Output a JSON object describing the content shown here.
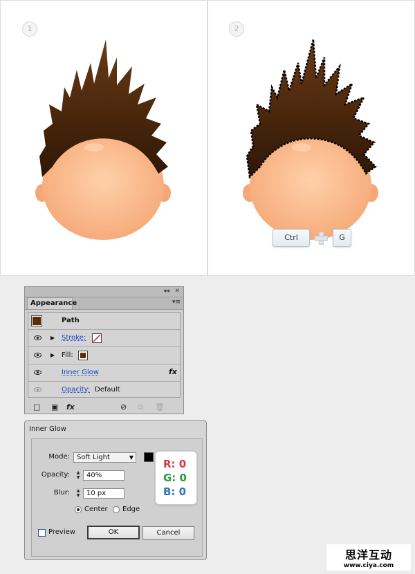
{
  "steps": {
    "one": "1",
    "two": "2"
  },
  "shortcut": {
    "ctrl": "Ctrl",
    "g": "G"
  },
  "appearance": {
    "tab": "Appearance",
    "object": "Path",
    "rows": {
      "stroke": "Stroke:",
      "fill": "Fill:",
      "inner_glow": "Inner Glow",
      "fx": "fx",
      "opacity_label": "Opacity:",
      "opacity_value": "Default"
    },
    "fill_color": "#5a2e0c",
    "stroke_color": "none"
  },
  "inner_glow": {
    "title": "Inner Glow",
    "mode_label": "Mode:",
    "mode_value": "Soft Light",
    "opacity_label": "Opacity:",
    "opacity_value": "40%",
    "blur_label": "Blur:",
    "blur_value": "10 px",
    "center_label": "Center",
    "edge_label": "Edge",
    "selected": "Center",
    "preview_label": "Preview",
    "ok": "OK",
    "cancel": "Cancel",
    "glow_color": "#000000"
  },
  "rgb": {
    "r": "R: 0",
    "g": "G: 0",
    "b": "B: 0",
    "r_color": "#e0343c",
    "g_color": "#2e9a3f",
    "b_color": "#2f78c0"
  },
  "watermark": {
    "main": "思洋互动",
    "url": "www.ciya.com"
  }
}
